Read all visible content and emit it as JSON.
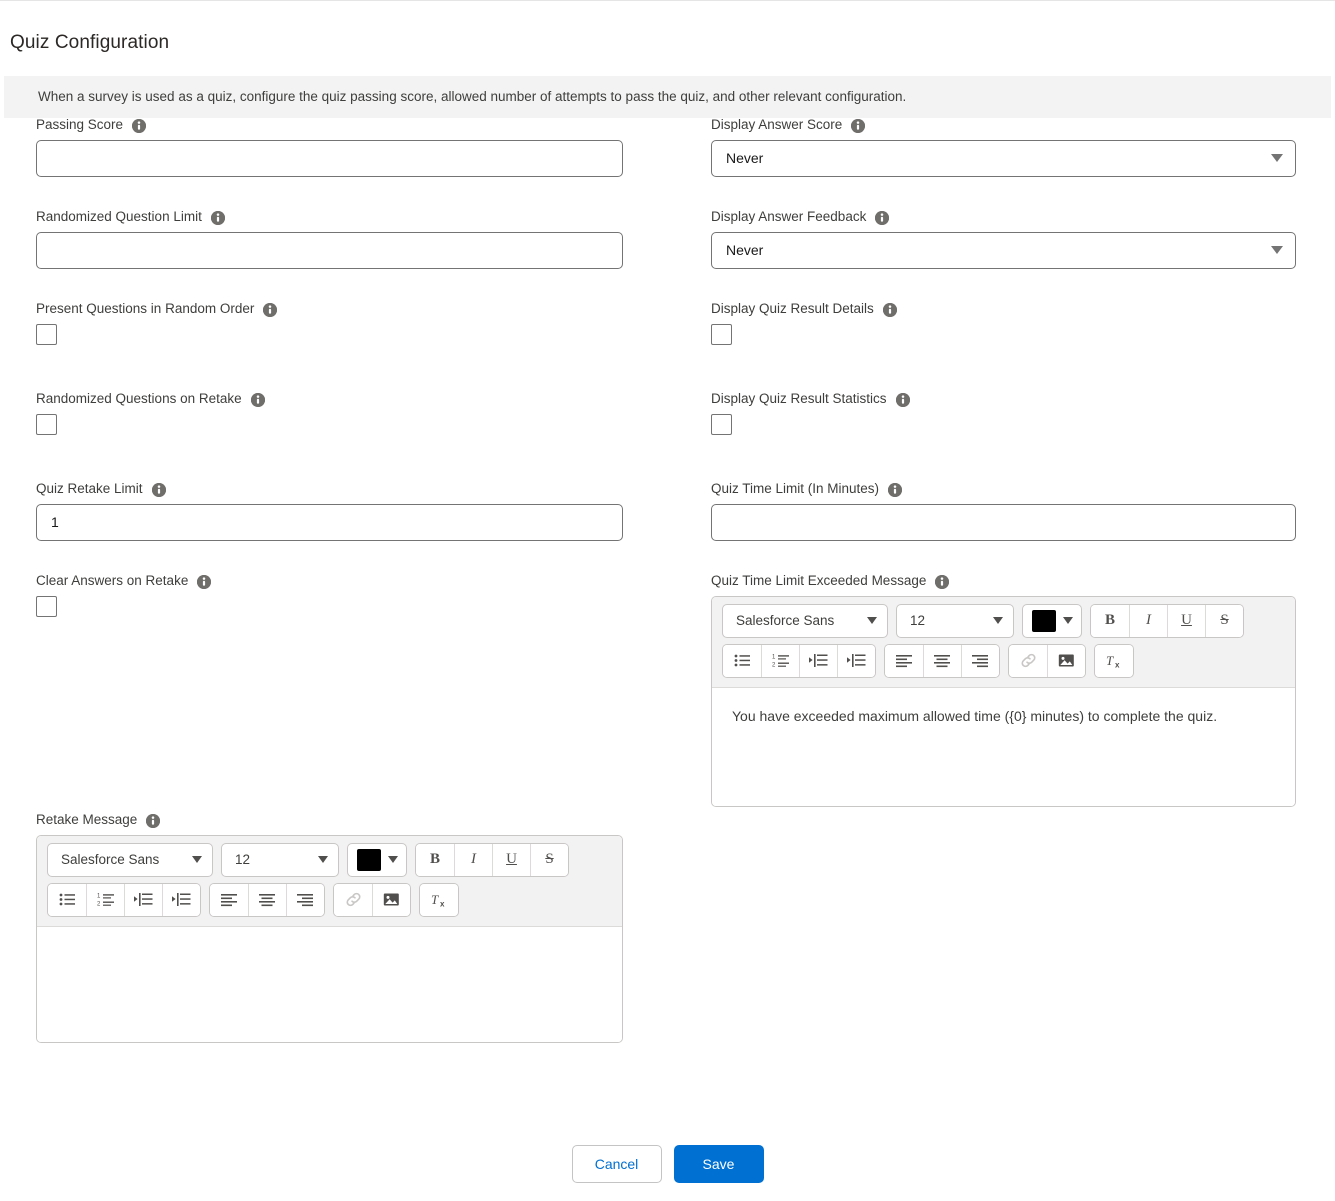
{
  "header": {
    "title": "Quiz Configuration",
    "banner": "When a survey is used as a quiz, configure the quiz passing score, allowed number of attempts to pass the quiz, and other relevant configuration."
  },
  "fields": {
    "passing_score": {
      "label": "Passing Score",
      "value": "",
      "placeholder": ""
    },
    "randomized_question_limit": {
      "label": "Randomized Question Limit",
      "value": "",
      "placeholder": ""
    },
    "present_random_order": {
      "label": "Present Questions in Random Order",
      "checked": false
    },
    "randomized_on_retake": {
      "label": "Randomized Questions on Retake",
      "checked": false
    },
    "quiz_retake_limit": {
      "label": "Quiz Retake Limit",
      "value": "1",
      "placeholder": ""
    },
    "clear_answers_on_retake": {
      "label": "Clear Answers on Retake",
      "checked": false
    },
    "display_answer_score": {
      "label": "Display Answer Score",
      "value": "Never",
      "options": [
        "Never"
      ]
    },
    "display_answer_feedback": {
      "label": "Display Answer Feedback",
      "value": "Never",
      "options": [
        "Never"
      ]
    },
    "display_quiz_result_details": {
      "label": "Display Quiz Result Details",
      "checked": false
    },
    "display_quiz_result_statistics": {
      "label": "Display Quiz Result Statistics",
      "checked": false
    },
    "quiz_time_limit": {
      "label": "Quiz Time Limit (In Minutes)",
      "value": "",
      "placeholder": ""
    },
    "time_limit_exceeded_message": {
      "label": "Quiz Time Limit Exceeded Message",
      "body": "You have exceeded maximum allowed time ({0} minutes) to complete the quiz."
    },
    "retake_message": {
      "label": "Retake Message",
      "body": ""
    }
  },
  "editor_toolbar": {
    "font_family": "Salesforce Sans",
    "font_size": "12",
    "text_color": "#000000",
    "bold_label": "B",
    "italic_label": "I",
    "underline_label": "U",
    "strikethrough_label": "S",
    "icons": {
      "bulleted_list": "bulleted-list-icon",
      "numbered_list": "numbered-list-icon",
      "indent": "indent-icon",
      "outdent": "outdent-icon",
      "align_left": "align-left-icon",
      "align_center": "align-center-icon",
      "align_right": "align-right-icon",
      "link": "link-icon",
      "image": "image-icon",
      "remove_format": "remove-formatting-icon"
    }
  },
  "footer": {
    "cancel_label": "Cancel",
    "save_label": "Save"
  },
  "colors": {
    "accent": "#0070d2",
    "banner_bg": "#f3f3f3",
    "toolbar_bg": "#f3f2f2",
    "border": "#747474",
    "info_icon": "#706e6b"
  }
}
